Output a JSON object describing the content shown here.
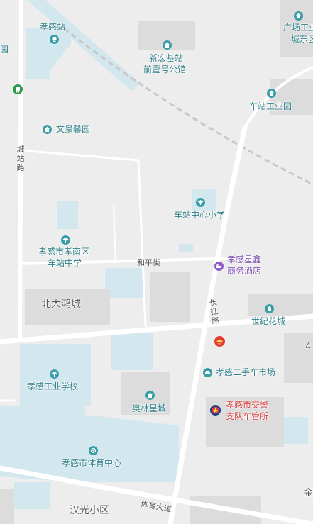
{
  "colors": {
    "background": "#ededed",
    "road": "#ffffff",
    "water": "#d3e7ef",
    "building": "#dcdcdc",
    "railway": "#c8c8c8",
    "poi_teal": "#3a9ea8",
    "poi_purple": "#8a5cc4",
    "poi_red": "#d64040",
    "metro_green": "#2e9a4e"
  },
  "labels": {
    "xiaogan_station": "孝感站",
    "xinhong_line1": "新宏基站",
    "xinhong_line2": "前壹号公馆",
    "guangchang_line1": "广场工业",
    "guangchang_line2": "城东区",
    "left_edge": "园",
    "chezhan_industrial": "车站工业园",
    "wenjing": "文景馨园",
    "chezhan_primary": "车站中心小学",
    "xiaonan_line1": "孝感市孝南区",
    "xiaonan_line2": "车站中学",
    "xingxin_line1": "孝感星鑫",
    "xingxin_line2": "商务酒店",
    "beidahong": "北大鸿城",
    "shiji": "世纪花城",
    "used_car": "孝感二手车市场",
    "industrial_school": "孝感工业学校",
    "aolin": "奥林星城",
    "traffic_line1": "孝感市交警",
    "traffic_line2": "支队车管所",
    "sports_center": "孝感市体育中心",
    "hanguang": "汉光小区",
    "right_edge_jin": "金",
    "right_edge_top": "4"
  },
  "roads": {
    "chengzhan": "城站路",
    "heping": "和平街",
    "changzheng": "长征路",
    "tiyu": "体育大道"
  },
  "icons": {
    "metro": "metro-icon",
    "station": "train-station-icon",
    "residential": "residential-icon",
    "school": "school-icon",
    "hotel": "hotel-icon",
    "gas": "gas-station-icon",
    "car": "car-icon",
    "police": "police-badge-icon",
    "sports": "sports-icon"
  }
}
